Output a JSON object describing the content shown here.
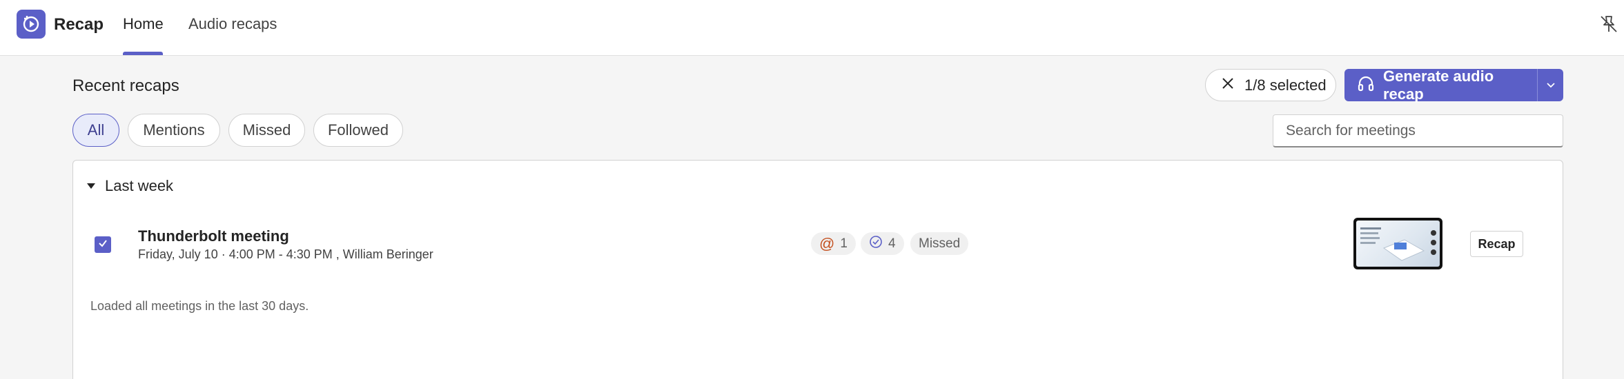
{
  "app": {
    "name": "Recap"
  },
  "tabs": [
    {
      "label": "Home",
      "active": true
    },
    {
      "label": "Audio recaps",
      "active": false
    }
  ],
  "header": {
    "section_title": "Recent recaps",
    "selection_label": "1/8 selected",
    "generate_label": "Generate audio recap"
  },
  "filters": [
    {
      "label": "All",
      "active": true
    },
    {
      "label": "Mentions",
      "active": false
    },
    {
      "label": "Missed",
      "active": false
    },
    {
      "label": "Followed",
      "active": false
    }
  ],
  "search": {
    "placeholder": "Search for meetings"
  },
  "group": {
    "label": "Last week",
    "expanded": true
  },
  "meeting": {
    "title": "Thunderbolt meeting",
    "subtitle": "Friday, July 10 · 4:00 PM - 4:30 PM , William Beringer",
    "selected": true,
    "mentions_count": "1",
    "tasks_count": "4",
    "status": "Missed",
    "recap_label": "Recap"
  },
  "footnote": "Loaded all meetings in the last 30 days.",
  "colors": {
    "accent": "#5b5fc7",
    "mention": "#c4501f",
    "background": "#f5f5f5"
  },
  "icons": [
    "recap-app-icon",
    "unpin-icon",
    "close-icon",
    "headphones-icon",
    "chevron-down-icon",
    "caret-down-icon",
    "checkmark-icon",
    "at-mention-icon",
    "task-check-icon"
  ]
}
